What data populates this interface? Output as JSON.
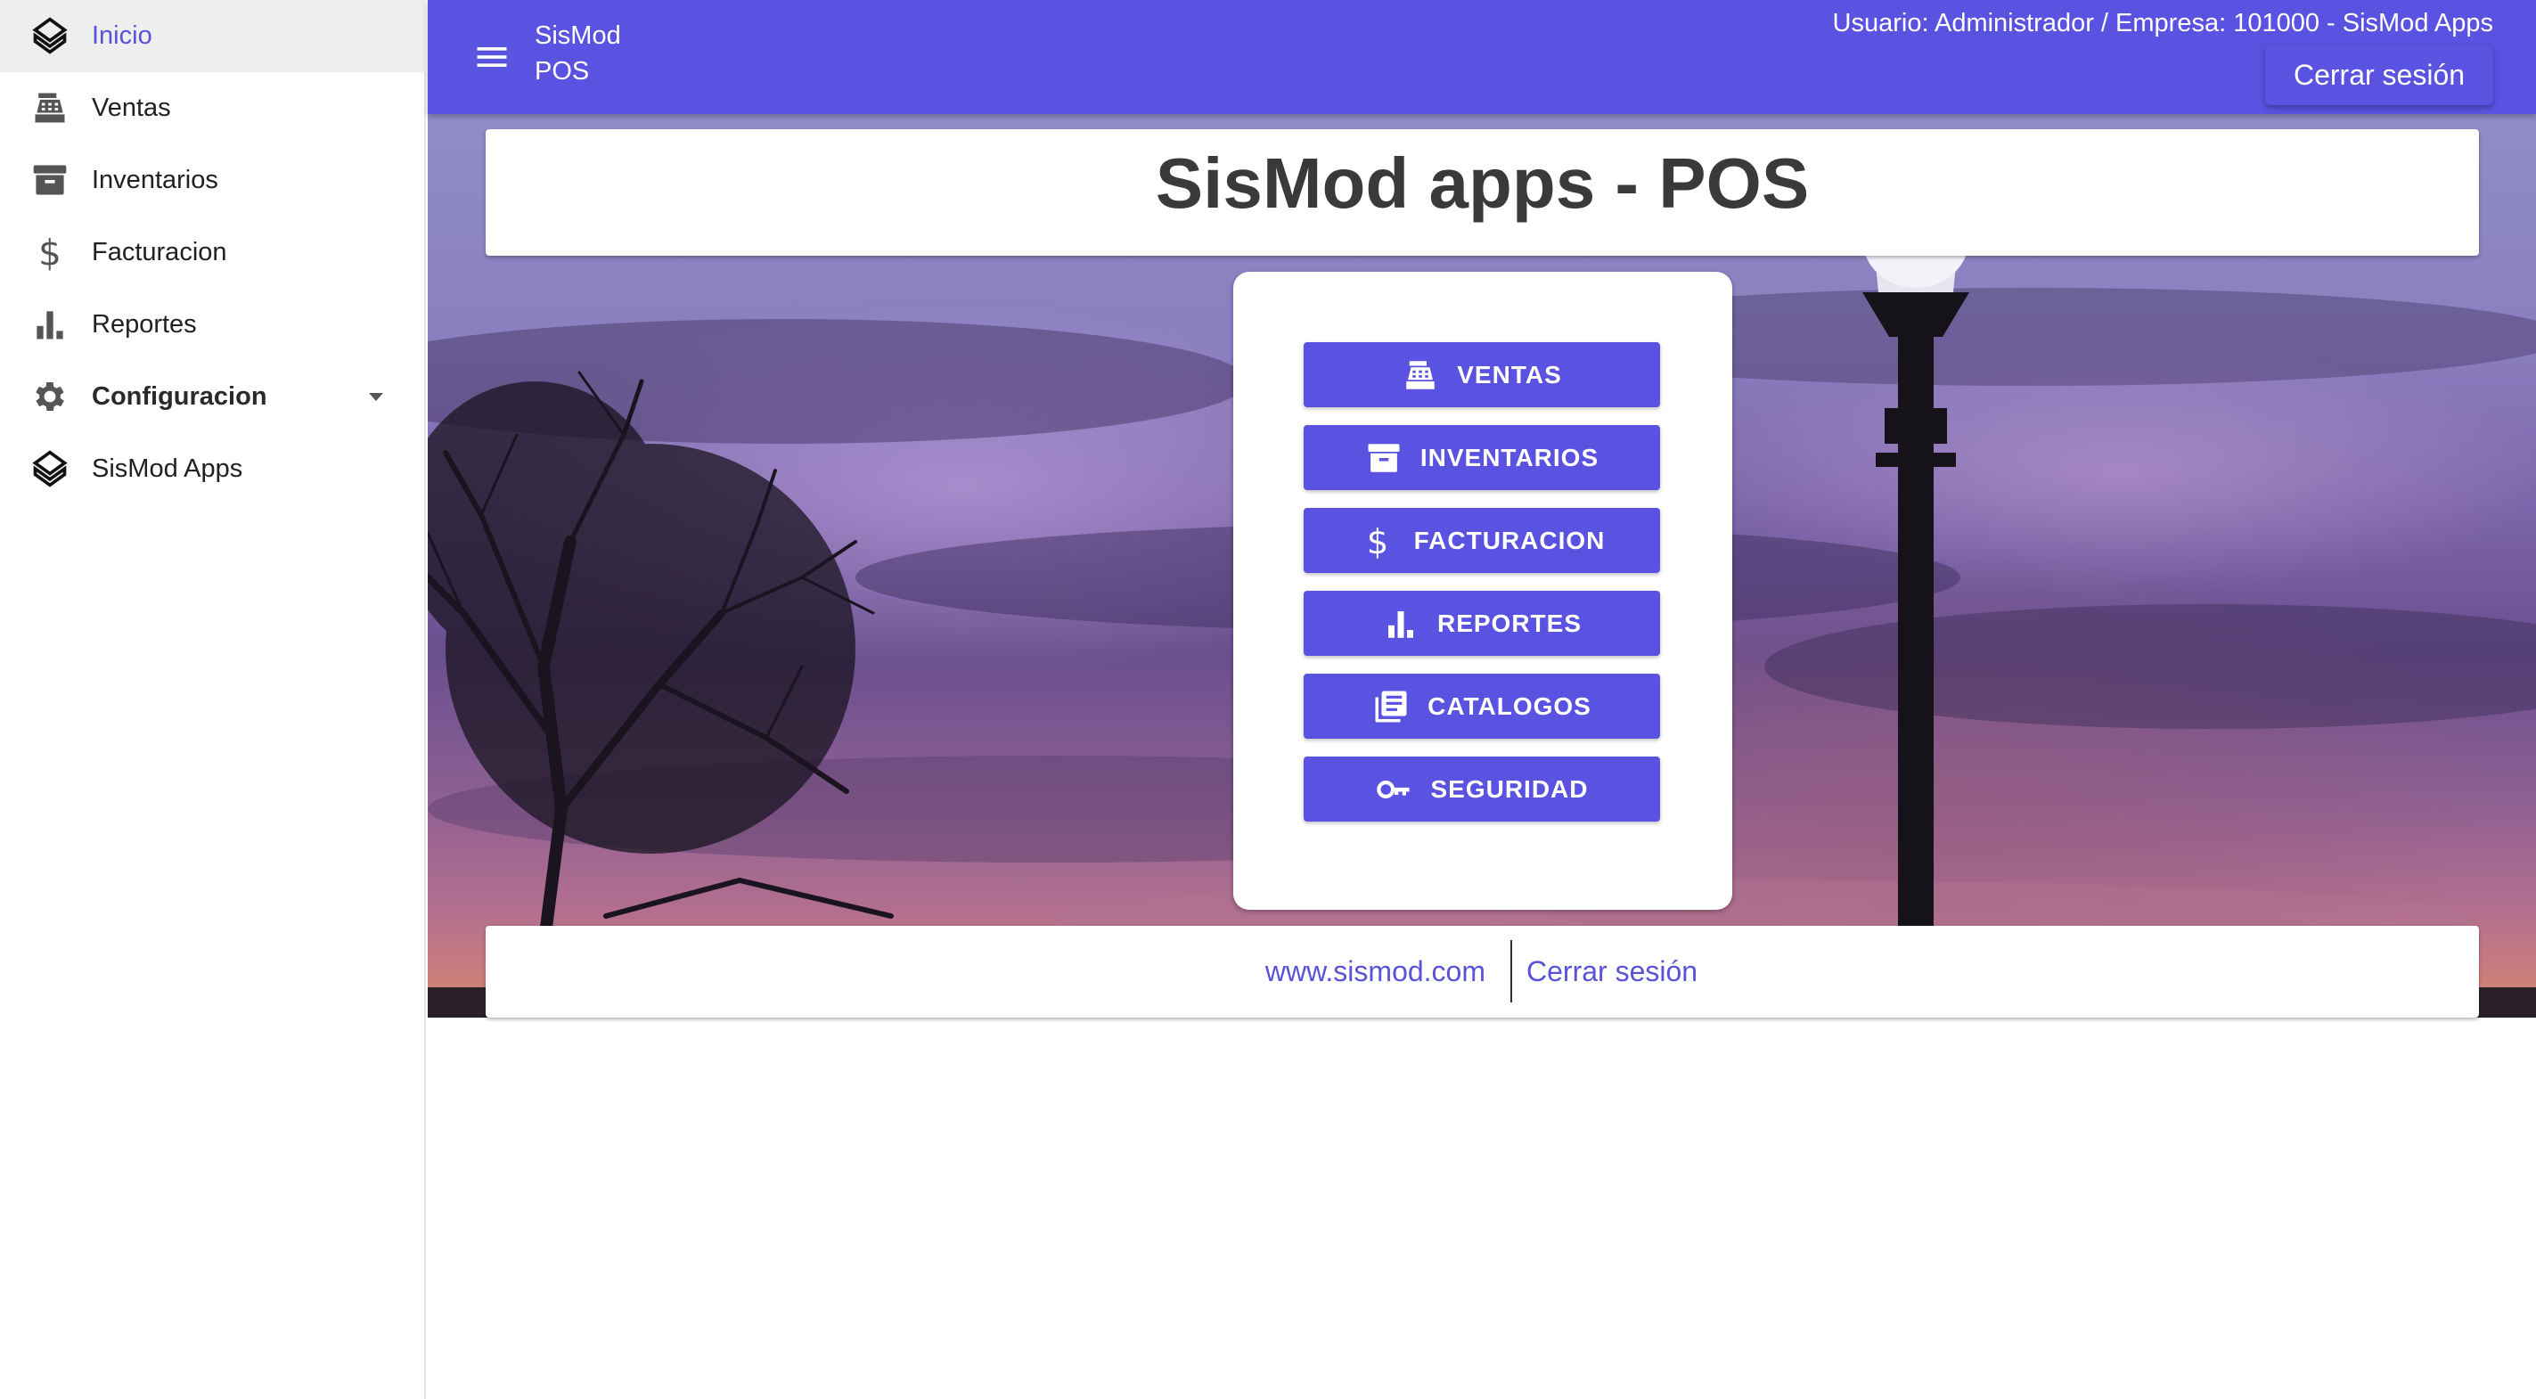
{
  "sidebar": {
    "items": [
      {
        "label": "Inicio",
        "icon": "sismod-logo-icon",
        "active": true
      },
      {
        "label": "Ventas",
        "icon": "cash-register-icon"
      },
      {
        "label": "Inventarios",
        "icon": "archive-icon"
      },
      {
        "label": "Facturacion",
        "icon": "dollar-icon"
      },
      {
        "label": "Reportes",
        "icon": "bar-chart-icon"
      },
      {
        "label": "Configuracion",
        "icon": "gear-icon",
        "expandable": true
      },
      {
        "label": "SisMod Apps",
        "icon": "sismod-logo-icon"
      }
    ]
  },
  "topbar": {
    "brand_line1": "SisMod",
    "brand_line2": "POS",
    "user_info": "Usuario: Administrador / Empresa: 101000 - SisMod Apps",
    "logout_label": "Cerrar sesión"
  },
  "main": {
    "title": "SisMod apps - POS",
    "buttons": [
      {
        "label": "VENTAS",
        "icon": "cash-register-icon"
      },
      {
        "label": "INVENTARIOS",
        "icon": "archive-icon"
      },
      {
        "label": "FACTURACION",
        "icon": "dollar-icon"
      },
      {
        "label": "REPORTES",
        "icon": "bar-chart-icon"
      },
      {
        "label": "CATALOGOS",
        "icon": "library-books-icon"
      },
      {
        "label": "SEGURIDAD",
        "icon": "key-icon"
      }
    ]
  },
  "footer": {
    "website": "www.sismod.com",
    "logout": "Cerrar sesión"
  },
  "colors": {
    "primary": "#5a52e0",
    "active_text": "#5a52d9",
    "sidebar_active_bg": "#eeeeee"
  }
}
